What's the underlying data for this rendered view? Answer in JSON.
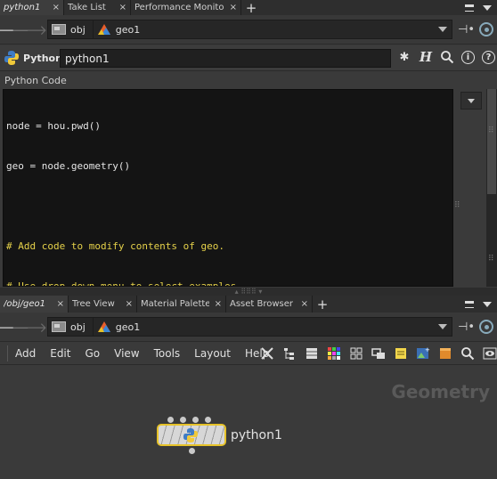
{
  "top_tabs": [
    {
      "label": "python1",
      "active": true
    },
    {
      "label": "Take List",
      "active": false
    },
    {
      "label": "Performance Monitor",
      "active": false
    }
  ],
  "top_path": {
    "crumbs": [
      "obj",
      "geo1"
    ]
  },
  "parm": {
    "op_type": "Python",
    "node_name": "python1",
    "icons": [
      "gear-icon",
      "help-h-icon",
      "search-icon",
      "info-icon",
      "help-icon"
    ]
  },
  "code": {
    "label": "Python Code",
    "lines": [
      {
        "text": "node = hou.pwd()",
        "comment": false
      },
      {
        "text": "geo = node.geometry()",
        "comment": false
      },
      {
        "text": "",
        "comment": false
      },
      {
        "text": "# Add code to modify contents of geo.",
        "comment": true
      },
      {
        "text": "# Use drop down menu to select examples.",
        "comment": true
      }
    ]
  },
  "bottom_tabs": [
    {
      "label": "/obj/geo1",
      "active": true
    },
    {
      "label": "Tree View",
      "active": false
    },
    {
      "label": "Material Palette",
      "active": false
    },
    {
      "label": "Asset Browser",
      "active": false
    }
  ],
  "bottom_path": {
    "crumbs": [
      "obj",
      "geo1"
    ]
  },
  "menu": [
    "Add",
    "Edit",
    "Go",
    "View",
    "Tools",
    "Layout",
    "Help"
  ],
  "network": {
    "context_label": "Geometry",
    "node_label": "python1"
  },
  "colors": {
    "node_border": "#e6c229",
    "comment": "#e6d24a",
    "code_bg": "#141414"
  }
}
